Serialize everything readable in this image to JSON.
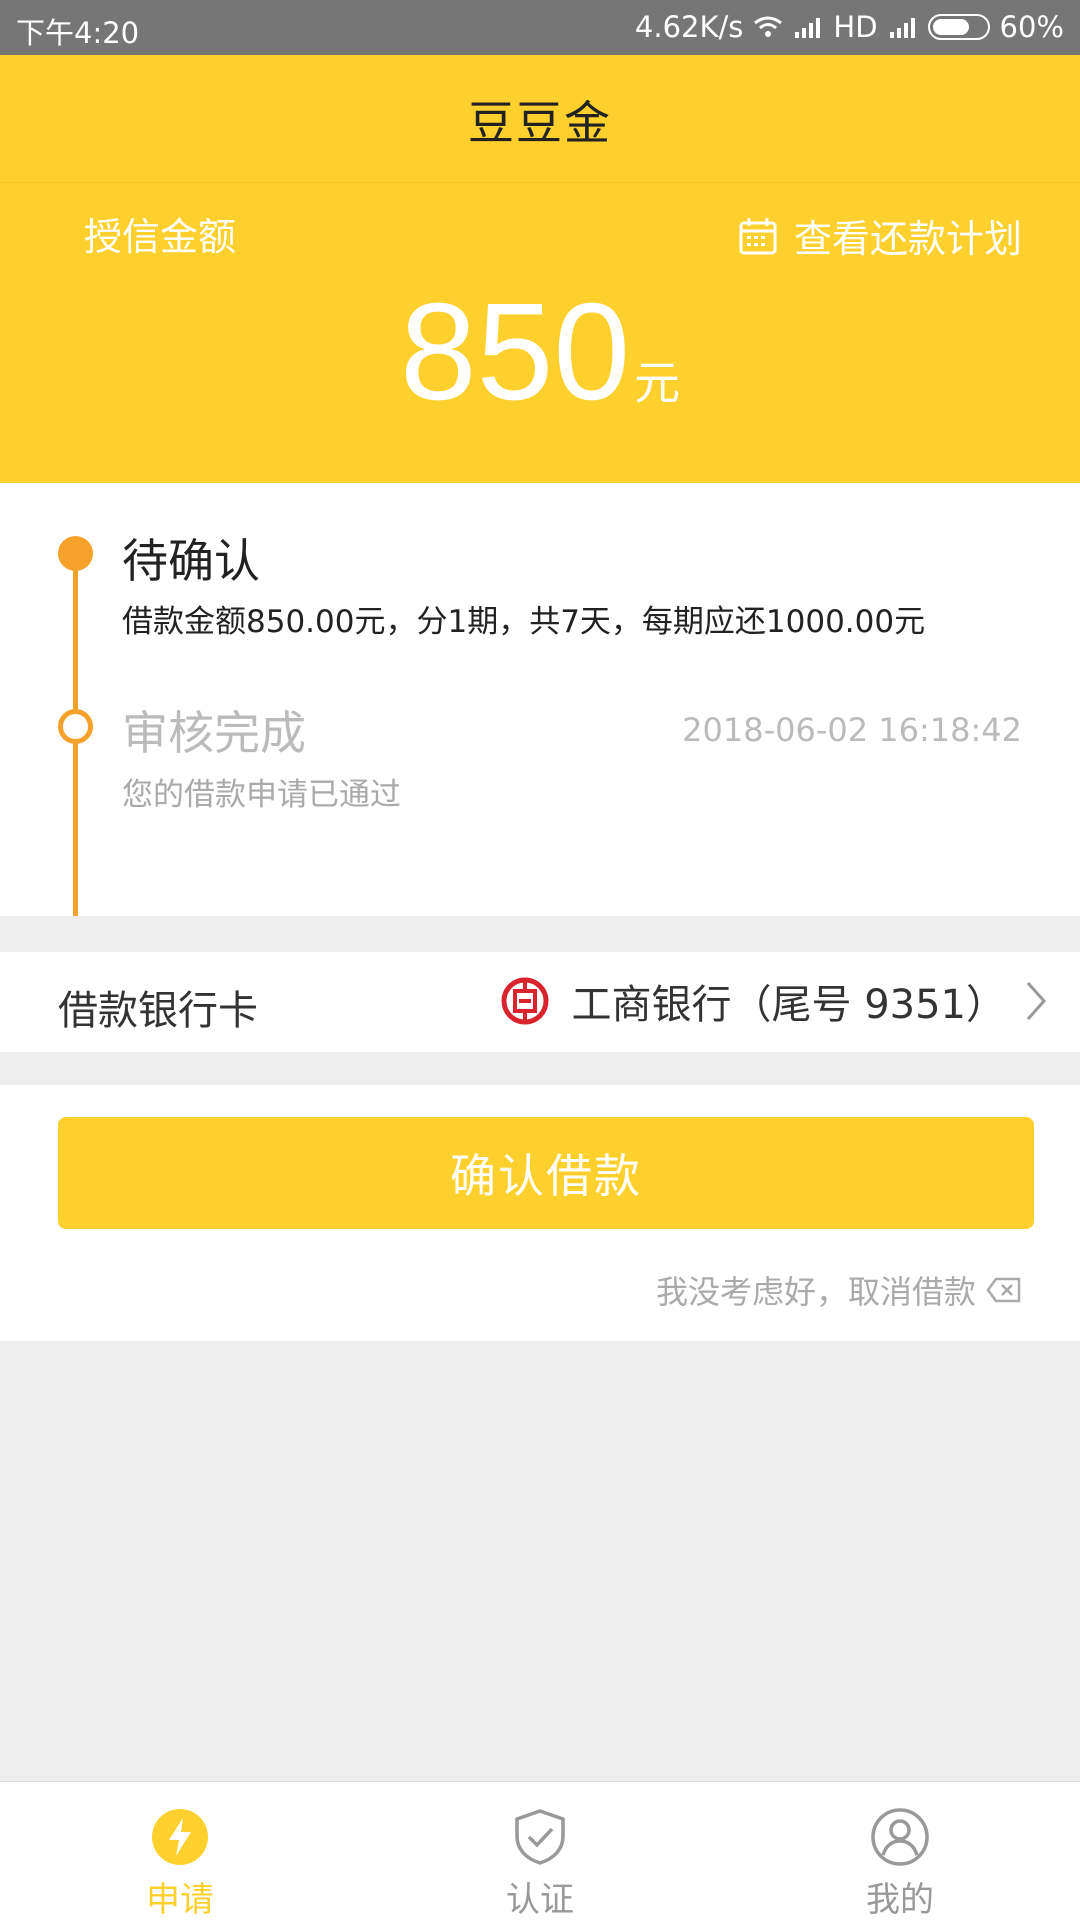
{
  "status_bar": {
    "time": "下午4:20",
    "speed": "4.62K/s",
    "network": "HD",
    "battery": "60%"
  },
  "header": {
    "title": "豆豆金"
  },
  "credit": {
    "label": "授信金额",
    "plan_link": "查看还款计划",
    "amount": "850",
    "unit": "元"
  },
  "timeline": {
    "step1": {
      "title": "待确认",
      "desc": "借款金额850.00元，分1期，共7天，每期应还1000.00元"
    },
    "step2": {
      "title": "审核完成",
      "time": "2018-06-02 16:18:42",
      "desc": "您的借款申请已通过"
    }
  },
  "bank": {
    "label": "借款银行卡",
    "name": "工商银行（尾号 9351）"
  },
  "actions": {
    "confirm": "确认借款",
    "cancel": "我没考虑好，取消借款"
  },
  "tabs": [
    {
      "label": "申请",
      "icon": "lightning-icon",
      "active": true
    },
    {
      "label": "认证",
      "icon": "shield-check-icon",
      "active": false
    },
    {
      "label": "我的",
      "icon": "user-icon",
      "active": false
    }
  ],
  "colors": {
    "brand": "#fed02e",
    "timeline": "#f6a12c",
    "bank_red": "#d9232d"
  }
}
